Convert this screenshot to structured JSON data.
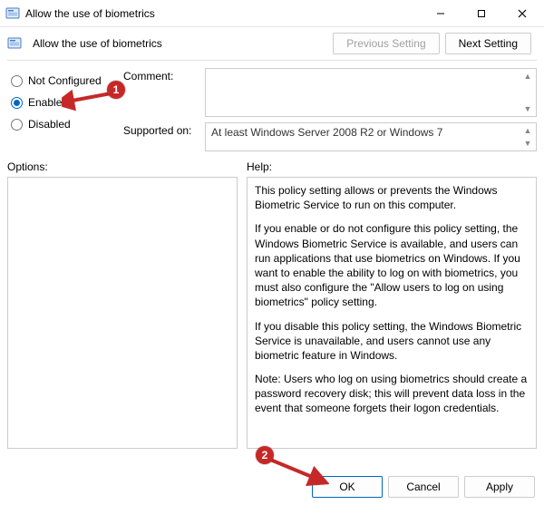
{
  "window": {
    "title": "Allow the use of biometrics",
    "subtitle": "Allow the use of biometrics"
  },
  "nav": {
    "previous": "Previous Setting",
    "next": "Next Setting"
  },
  "config": {
    "not_configured": "Not Configured",
    "enabled": "Enabled",
    "disabled": "Disabled",
    "comment_label": "Comment:",
    "comment_value": "",
    "supported_label": "Supported on:",
    "supported_value": "At least Windows Server 2008 R2 or Windows 7"
  },
  "lower": {
    "options_label": "Options:",
    "help_label": "Help:",
    "help_p1": "This policy setting allows or prevents the Windows Biometric Service to run on this computer.",
    "help_p2": "If you enable or do not configure this policy setting, the Windows Biometric Service is available, and users can run applications that use biometrics on Windows. If you want to enable the ability to log on with biometrics, you must also configure the \"Allow users to log on using biometrics\" policy setting.",
    "help_p3": "If you disable this policy setting, the Windows Biometric Service is unavailable, and users cannot use any biometric feature in Windows.",
    "help_p4": "Note: Users who log on using biometrics should create a password recovery disk; this will prevent data loss in the event that someone forgets their logon credentials."
  },
  "footer": {
    "ok": "OK",
    "cancel": "Cancel",
    "apply": "Apply"
  },
  "annotations": {
    "badge1": "1",
    "badge2": "2"
  }
}
